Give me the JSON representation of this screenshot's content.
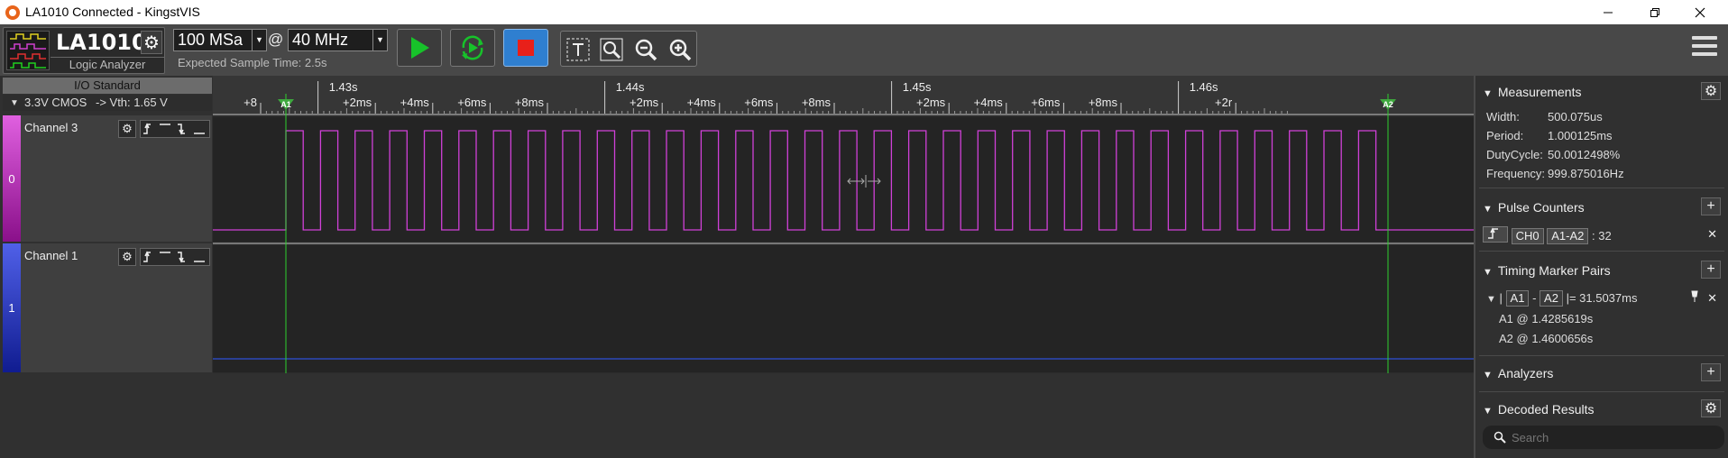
{
  "window": {
    "title": "LA1010 Connected - KingstVIS",
    "minimize_icon": "minimize-icon",
    "restore_icon": "restore-icon",
    "close_icon": "close-icon"
  },
  "toolbar": {
    "device_name": "LA1010",
    "device_sub": "Logic Analyzer",
    "sample_depth": "100 MSa",
    "at": "@",
    "sample_rate": "40 MHz",
    "expected": "Expected Sample Time: 2.5s",
    "colors": {
      "run": "#17c22a",
      "stop": "#e8201a",
      "stop_bg": "#2f7fd0"
    }
  },
  "io": {
    "header": "I/O Standard",
    "standard": "3.3V CMOS",
    "vth": "-> Vth: 1.65 V"
  },
  "channels": [
    {
      "name": "Channel 3",
      "index": "0",
      "color": "#c020d0",
      "wave_color": "#d040d8"
    },
    {
      "name": "Channel 1",
      "index": "1",
      "color": "#2a3ec0",
      "wave_color": "#2f4fd8"
    }
  ],
  "ruler": {
    "labels": [
      "+8",
      "1.43s",
      "+2ms",
      "+4ms",
      "+6ms",
      "+8ms",
      "1.44s",
      "+2ms",
      "+4ms",
      "+6ms",
      "+8ms",
      "1.45s",
      "+2ms",
      "+4ms",
      "+6ms",
      "+8ms",
      "1.46s",
      "+2r"
    ],
    "markers": [
      "A1",
      "A2"
    ]
  },
  "waveform": {
    "pulse_count": 32
  },
  "measurements": {
    "title": "Measurements",
    "rows": [
      {
        "label": "Width:",
        "value": "500.075us"
      },
      {
        "label": "Period:",
        "value": "1.000125ms"
      },
      {
        "label": "DutyCycle:",
        "value": "50.0012498%"
      },
      {
        "label": "Frequency:",
        "value": "999.875016Hz"
      }
    ]
  },
  "pulse_counters": {
    "title": "Pulse Counters",
    "channel": "CH0",
    "range": "A1-A2",
    "count": ": 32"
  },
  "timing_pairs": {
    "title": "Timing Marker Pairs",
    "a": "A1",
    "dash": "-",
    "b": "A2",
    "result": "|= 31.5037ms",
    "open": "|",
    "a1": "A1 @ 1.4285619s",
    "a2": "A2 @ 1.4600656s"
  },
  "analyzers": {
    "title": "Analyzers"
  },
  "decoded": {
    "title": "Decoded Results",
    "search_placeholder": "Search"
  },
  "plus": "+",
  "close_x": "✕"
}
